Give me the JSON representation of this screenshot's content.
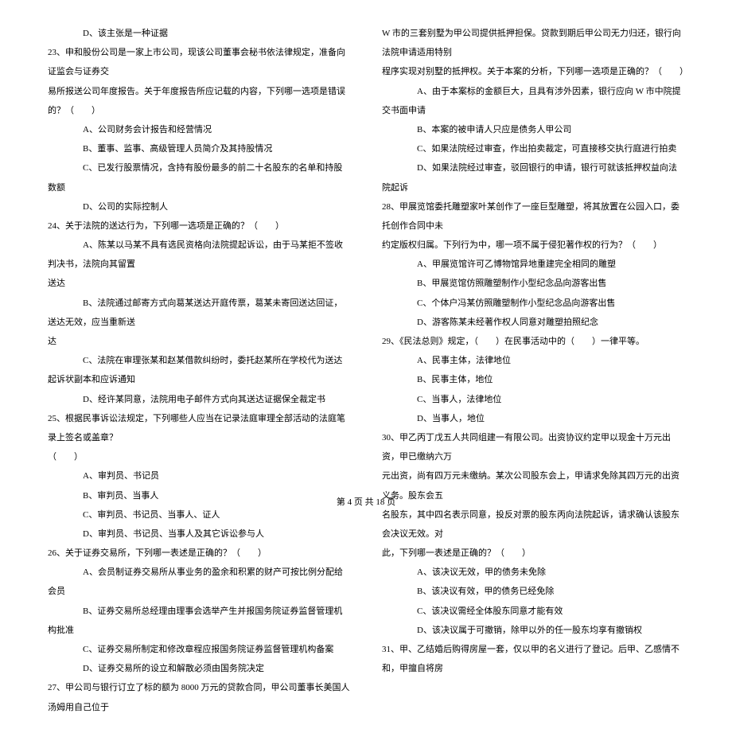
{
  "left": {
    "lines": [
      {
        "cls": "option",
        "text": "D、该主张是一种证据"
      },
      {
        "cls": "question",
        "text": "23、申和股份公司是一家上市公司，现该公司董事会秘书依法律规定，准备向证监会与证券交"
      },
      {
        "cls": "cont",
        "text": "易所报送公司年度报告。关于年度报告所应记载的内容，下列哪一选项是错误的？（　　）"
      },
      {
        "cls": "option",
        "text": "A、公司财务会计报告和经营情况"
      },
      {
        "cls": "option",
        "text": "B、董事、监事、高级管理人员简介及其持股情况"
      },
      {
        "cls": "option",
        "text": "C、已发行股票情况，含持有股份最多的前二十名股东的名单和持股数额"
      },
      {
        "cls": "option",
        "text": "D、公司的实际控制人"
      },
      {
        "cls": "question",
        "text": "24、关于法院的送达行为，下列哪一选项是正确的？（　　）"
      },
      {
        "cls": "option",
        "text": "A、陈某以马某不具有选民资格向法院提起诉讼，由于马某拒不签收判决书，法院向其留置"
      },
      {
        "cls": "cont",
        "text": "送达"
      },
      {
        "cls": "option",
        "text": "B、法院通过邮寄方式向葛某送达开庭传票，葛某未寄回送达回证，送达无效，应当重新送"
      },
      {
        "cls": "cont",
        "text": "达"
      },
      {
        "cls": "option",
        "text": "C、法院在审理张某和赵某借款纠纷时，委托赵某所在学校代为送达起诉状副本和应诉通知"
      },
      {
        "cls": "option",
        "text": "D、经许某同意，法院用电子邮件方式向其送达证据保全裁定书"
      },
      {
        "cls": "question",
        "text": "25、根据民事诉讼法规定，下列哪些人应当在记录法庭审理全部活动的法庭笔录上签名或盖章？"
      },
      {
        "cls": "cont",
        "text": "（　　）"
      },
      {
        "cls": "option",
        "text": "A、审判员、书记员"
      },
      {
        "cls": "option",
        "text": "B、审判员、当事人"
      },
      {
        "cls": "option",
        "text": "C、审判员、书记员、当事人、证人"
      },
      {
        "cls": "option",
        "text": "D、审判员、书记员、当事人及其它诉讼参与人"
      },
      {
        "cls": "question",
        "text": "26、关于证券交易所，下列哪一表述是正确的？（　　）"
      },
      {
        "cls": "option",
        "text": "A、会员制证券交易所从事业务的盈余和积累的财产可按比例分配给会员"
      },
      {
        "cls": "option",
        "text": "B、证券交易所总经理由理事会选举产生并报国务院证券监督管理机构批准"
      },
      {
        "cls": "option",
        "text": "C、证券交易所制定和修改章程应报国务院证券监督管理机构备案"
      },
      {
        "cls": "option",
        "text": "D、证券交易所的设立和解散必须由国务院决定"
      },
      {
        "cls": "question",
        "text": "27、甲公司与银行订立了标的额为 8000 万元的贷款合同，甲公司董事长美国人汤姆用自己位于"
      }
    ]
  },
  "right": {
    "lines": [
      {
        "cls": "cont",
        "text": "W 市的三套别墅为甲公司提供抵押担保。贷款到期后甲公司无力归还，银行向法院申请适用特别"
      },
      {
        "cls": "cont",
        "text": "程序实现对别墅的抵押权。关于本案的分析，下列哪一选项是正确的？（　　）"
      },
      {
        "cls": "option",
        "text": "A、由于本案标的金额巨大，且具有涉外因素，银行应向 W 市中院提交书面申请"
      },
      {
        "cls": "option",
        "text": "B、本案的被申请人只应是债务人甲公司"
      },
      {
        "cls": "option",
        "text": "C、如果法院经过审查，作出拍卖裁定，可直接移交执行庭进行拍卖"
      },
      {
        "cls": "option",
        "text": "D、如果法院经过审查，驳回银行的申请，银行可就该抵押权益向法院起诉"
      },
      {
        "cls": "question",
        "text": "28、甲展览馆委托雕塑家叶某创作了一座巨型雕塑，将其放置在公园入口，委托创作合同中未"
      },
      {
        "cls": "cont",
        "text": "约定版权归属。下列行为中，哪一项不属于侵犯著作权的行为？（　　）"
      },
      {
        "cls": "option",
        "text": "A、甲展览馆许可乙博物馆异地重建完全相同的雕塑"
      },
      {
        "cls": "option",
        "text": "B、甲展览馆仿照雕塑制作小型纪念品向游客出售"
      },
      {
        "cls": "option",
        "text": "C、个体户冯某仿照雕塑制作小型纪念品向游客出售"
      },
      {
        "cls": "option",
        "text": "D、游客陈某未经著作权人同意对雕塑拍照纪念"
      },
      {
        "cls": "question",
        "text": "29、《民法总则》规定，（　　）在民事活动中的（　　）一律平等。"
      },
      {
        "cls": "option",
        "text": "A、民事主体，法律地位"
      },
      {
        "cls": "option",
        "text": "B、民事主体，地位"
      },
      {
        "cls": "option",
        "text": "C、当事人，法律地位"
      },
      {
        "cls": "option",
        "text": "D、当事人，地位"
      },
      {
        "cls": "question",
        "text": "30、甲乙丙丁戊五人共同组建一有限公司。出资协议约定甲以现金十万元出资，甲已缴纳六万"
      },
      {
        "cls": "cont",
        "text": "元出资，尚有四万元未缴纳。某次公司股东会上，甲请求免除其四万元的出资义务。股东会五"
      },
      {
        "cls": "cont",
        "text": "名股东，其中四名表示同意，投反对票的股东丙向法院起诉，请求确认该股东会决议无效。对"
      },
      {
        "cls": "cont",
        "text": "此，下列哪一表述是正确的？（　　）"
      },
      {
        "cls": "option",
        "text": "A、该决议无效，甲的债务未免除"
      },
      {
        "cls": "option",
        "text": "B、该决议有效，甲的债务已经免除"
      },
      {
        "cls": "option",
        "text": "C、该决议需经全体股东同意才能有效"
      },
      {
        "cls": "option",
        "text": "D、该决议属于可撤销，除甲以外的任一股东均享有撤销权"
      },
      {
        "cls": "question",
        "text": "31、甲、乙结婚后购得房屋一套，仅以甲的名义进行了登记。后甲、乙感情不和，甲擅自将房"
      }
    ]
  },
  "footer": "第 4 页 共 18 页"
}
